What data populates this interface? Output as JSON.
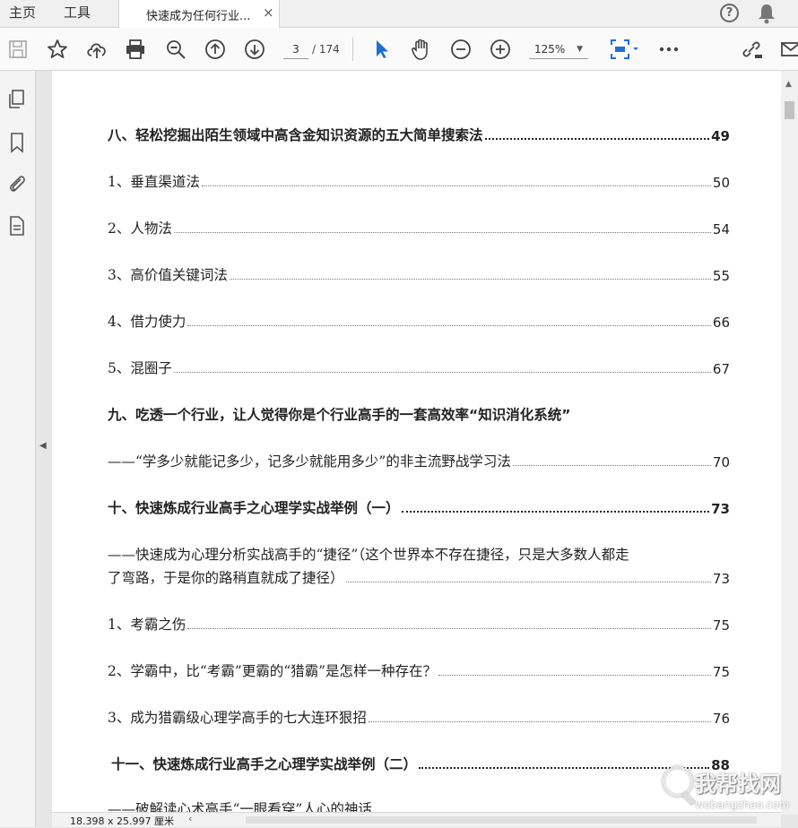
{
  "tabs": {
    "home": "主页",
    "tools": "工具",
    "document": "快速成为任何行业...",
    "close": "×"
  },
  "toolbar": {
    "current_page": "3",
    "total_pages": "/ 174",
    "zoom": "125%",
    "icons": [
      "save-icon",
      "star-icon",
      "cloud-upload-icon",
      "print-icon",
      "zoom-out-search-icon",
      "page-up-icon",
      "page-down-icon",
      "select-cursor-icon",
      "hand-tool-icon",
      "zoom-minus-icon",
      "zoom-plus-icon",
      "fit-page-icon",
      "more-icon",
      "share-link-icon",
      "mail-icon"
    ],
    "accent_color": "#1f6fd1"
  },
  "toc": [
    {
      "text": "八、轻松挖掘出陌生领域中高含金知识资源的五大简单搜索法",
      "page": "49",
      "bold": true
    },
    {
      "text": "1、垂直渠道法",
      "page": "50",
      "bold": false
    },
    {
      "text": "2、人物法",
      "page": "54",
      "bold": false
    },
    {
      "text": "3、高价值关键词法",
      "page": "55",
      "bold": false
    },
    {
      "text": "4、借力使力",
      "page": "66",
      "bold": false
    },
    {
      "text": "5、混圈子",
      "page": "67",
      "bold": false
    },
    {
      "text": "九、吃透一个行业，让人觉得你是个行业高手的一套高效率“知识消化系统”",
      "page": "",
      "bold": true
    },
    {
      "text": "——“学多少就能记多少，记多少就能用多少”的非主流野战学习法",
      "page": "70",
      "bold": false
    },
    {
      "text": "十、快速炼成行业高手之心理学实战举例（一）",
      "page": "73",
      "bold": true
    },
    {
      "text": "——快速成为心理分析实战高手的“捷径”（这个世界本不存在捷径，只是大多数人都走",
      "page": "",
      "bold": false
    },
    {
      "text": "了弯路，于是你的路稍直就成了捷径）",
      "page": "73",
      "bold": false
    },
    {
      "text": "1、考霸之伤",
      "page": "75",
      "bold": false
    },
    {
      "text": "2、学霸中，比“考霸”更霸的“猎霸”是怎样一种存在？",
      "page": "75",
      "bold": false
    },
    {
      "text": "3、成为猎霸级心理学高手的七大连环狠招",
      "page": "76",
      "bold": false
    },
    {
      "text": "十一、快速炼成行业高手之心理学实战举例（二）",
      "page": "88",
      "bold": true
    },
    {
      "text": "——破解读心术高手“一眼看穿”人心的神话",
      "page": "",
      "bold": false
    }
  ],
  "status": {
    "dimensions": "18.398 x 25.997 厘米"
  },
  "watermark": {
    "main": "我帮找网",
    "url": "wobangzhao.com"
  }
}
